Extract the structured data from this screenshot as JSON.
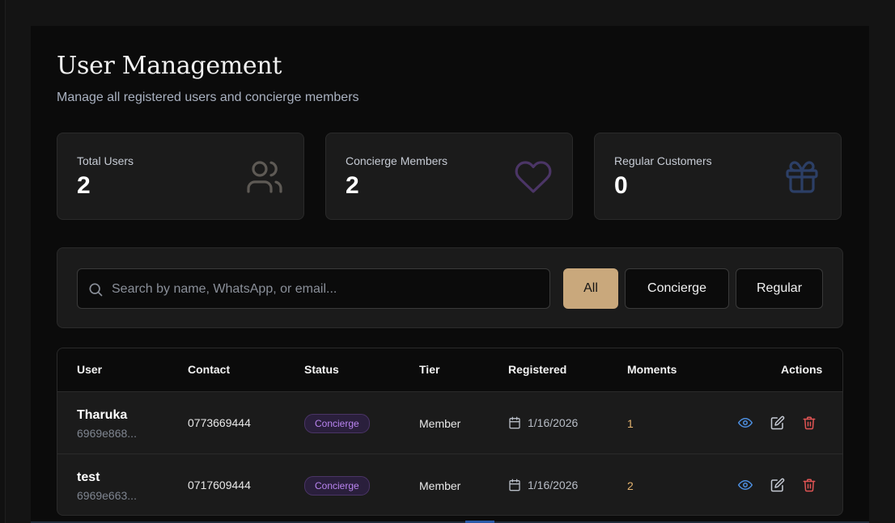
{
  "header": {
    "title": "User Management",
    "subtitle": "Manage all registered users and concierge members"
  },
  "stats": [
    {
      "label": "Total Users",
      "value": "2",
      "icon": "users-icon",
      "color": "#5e5a55"
    },
    {
      "label": "Concierge Members",
      "value": "2",
      "icon": "heart-icon",
      "color": "#4b3566"
    },
    {
      "label": "Regular Customers",
      "value": "0",
      "icon": "gift-icon",
      "color": "#2c3f66"
    }
  ],
  "filters": {
    "search_placeholder": "Search by name, WhatsApp, or email...",
    "all_label": "All",
    "concierge_label": "Concierge",
    "regular_label": "Regular",
    "active": "All",
    "accent": "#c9a87c"
  },
  "table": {
    "columns": [
      "User",
      "Contact",
      "Status",
      "Tier",
      "Registered",
      "Moments",
      "Actions"
    ],
    "rows": [
      {
        "name": "Tharuka",
        "id": "6969e868...",
        "contact": "0773669444",
        "status": "Concierge",
        "tier": "Member",
        "registered": "1/16/2026",
        "moments": "1"
      },
      {
        "name": "test",
        "id": "6969e663...",
        "contact": "0717609444",
        "status": "Concierge",
        "tier": "Member",
        "registered": "1/16/2026",
        "moments": "2"
      }
    ],
    "action_icons": [
      "eye-icon",
      "edit-icon",
      "trash-icon"
    ]
  }
}
